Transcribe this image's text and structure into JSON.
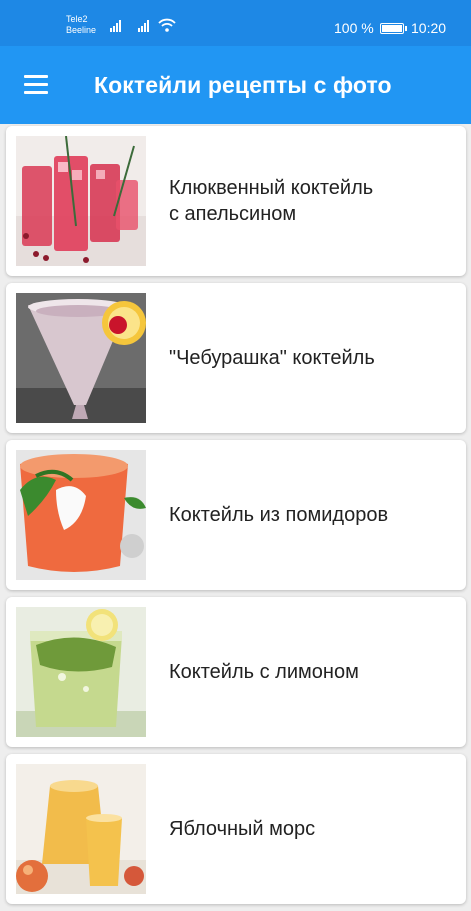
{
  "status_bar": {
    "carrier_1": "Tele2",
    "carrier_2": "Beeline",
    "battery_percent": "100 %",
    "battery_level": 1.0,
    "time": "10:20"
  },
  "app_bar": {
    "title": "Коктейли рецепты с фото",
    "menu_icon": "hamburger-menu-icon"
  },
  "recipes": [
    {
      "title": "Клюквенный коктейль\nс апельсином",
      "image": "cranberry-cocktail-photo"
    },
    {
      "title": "\"Чебурашка\" коктейль",
      "image": "cheburashka-cocktail-photo"
    },
    {
      "title": "Коктейль из помидоров",
      "image": "tomato-cocktail-photo"
    },
    {
      "title": "Коктейль с лимоном",
      "image": "lemon-cocktail-photo"
    },
    {
      "title": "Яблочный морс",
      "image": "apple-mors-photo"
    }
  ],
  "colors": {
    "status_bar": "#1e88e5",
    "app_bar": "#2196f3",
    "background": "#eeeeee",
    "card": "#ffffff"
  }
}
